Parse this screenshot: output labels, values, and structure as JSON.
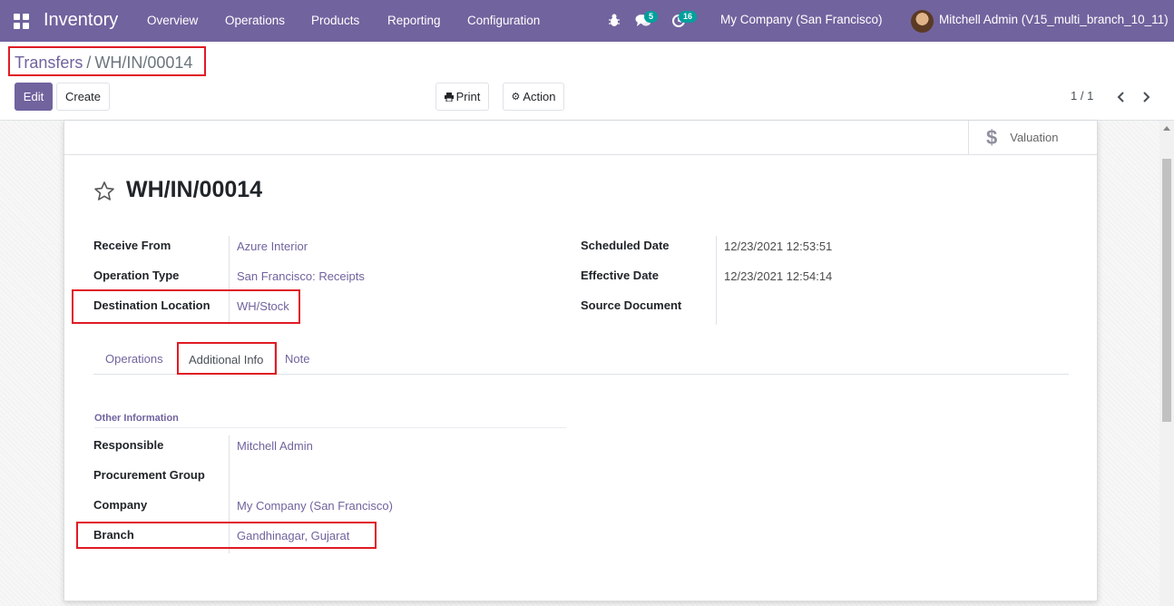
{
  "navbar": {
    "app_name": "Inventory",
    "menu": [
      "Overview",
      "Operations",
      "Products",
      "Reporting",
      "Configuration"
    ],
    "messages_count": "5",
    "activities_count": "16",
    "company": "My Company (San Francisco)",
    "user": "Mitchell Admin (V15_multi_branch_10_11)"
  },
  "breadcrumb": {
    "parent": "Transfers",
    "separator": "/",
    "current": "WH/IN/00014"
  },
  "buttons": {
    "edit": "Edit",
    "create": "Create",
    "print": "Print",
    "action": "Action"
  },
  "pager": {
    "value": "1 / 1"
  },
  "smart_buttons": {
    "valuation": "Valuation"
  },
  "record": {
    "name": "WH/IN/00014",
    "left_fields": [
      {
        "label": "Receive From",
        "value": "Azure Interior"
      },
      {
        "label": "Operation Type",
        "value": "San Francisco: Receipts"
      },
      {
        "label": "Destination Location",
        "value": "WH/Stock"
      }
    ],
    "right_fields": [
      {
        "label": "Scheduled Date",
        "value": "12/23/2021 12:53:51"
      },
      {
        "label": "Effective Date",
        "value": "12/23/2021 12:54:14"
      },
      {
        "label": "Source Document",
        "value": ""
      }
    ]
  },
  "tabs": [
    "Operations",
    "Additional Info",
    "Note"
  ],
  "active_tab": "Additional Info",
  "additional_info": {
    "group_title": "Other Information",
    "fields": [
      {
        "label": "Responsible",
        "value": "Mitchell Admin"
      },
      {
        "label": "Procurement Group",
        "value": ""
      },
      {
        "label": "Company",
        "value": "My Company (San Francisco)"
      },
      {
        "label": "Branch",
        "value": "Gandhinagar, Gujarat"
      }
    ]
  },
  "colors": {
    "brand": "#71639e",
    "highlight": "#e01b24",
    "badge": "#00a09d"
  }
}
